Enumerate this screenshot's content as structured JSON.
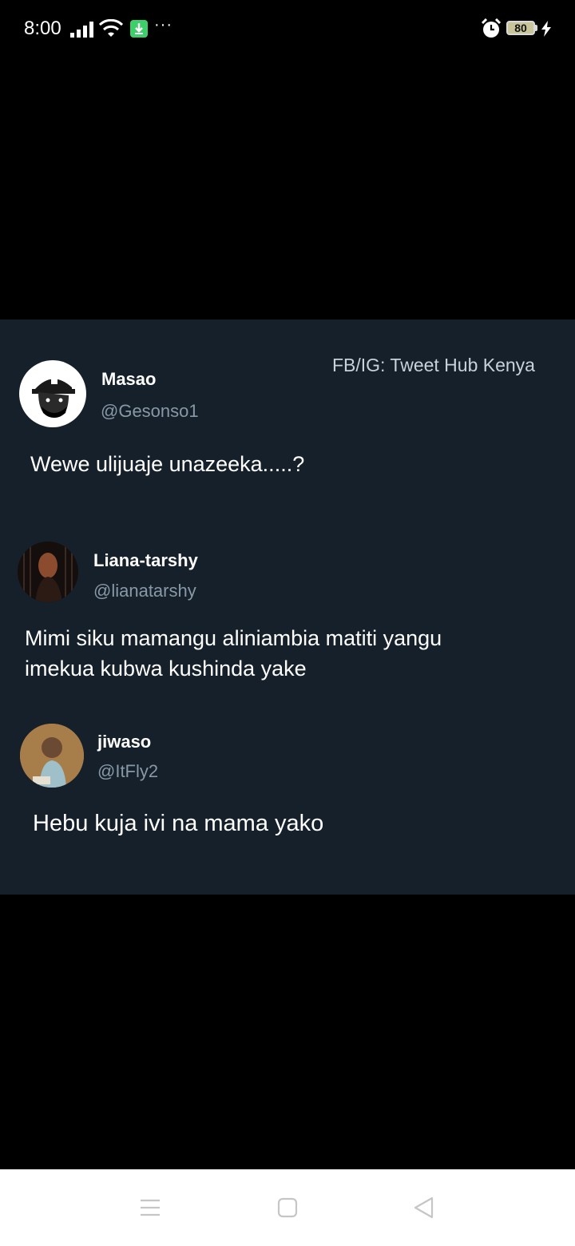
{
  "status_bar": {
    "time": "8:00",
    "icons": [
      "signal-icon",
      "wifi-icon",
      "download-icon",
      "more-icon",
      "alarm-icon",
      "battery-icon",
      "charging-icon"
    ],
    "more_glyph": "···",
    "battery_level": "80"
  },
  "watermark": "FB/IG: Tweet Hub Kenya",
  "tweets": [
    {
      "name": "Masao",
      "handle": "@Gesonso1",
      "text": "Wewe ulijuaje unazeeka.....?"
    },
    {
      "name": "Liana-tarshy",
      "handle": "@lianatarshy",
      "text_line1": "Mimi siku mamangu aliniambia matiti yangu",
      "text_line2": "imekua kubwa kushinda yake"
    },
    {
      "name": "jiwaso",
      "handle": "@ItFly2",
      "text": "Hebu kuja ivi na mama yako"
    }
  ],
  "nav_bar": {
    "buttons": [
      "menu-icon",
      "home-icon",
      "back-icon"
    ]
  },
  "colors": {
    "card_bg": "#15202b",
    "handle": "#8899a6",
    "download_badge": "#3ecf6a"
  }
}
